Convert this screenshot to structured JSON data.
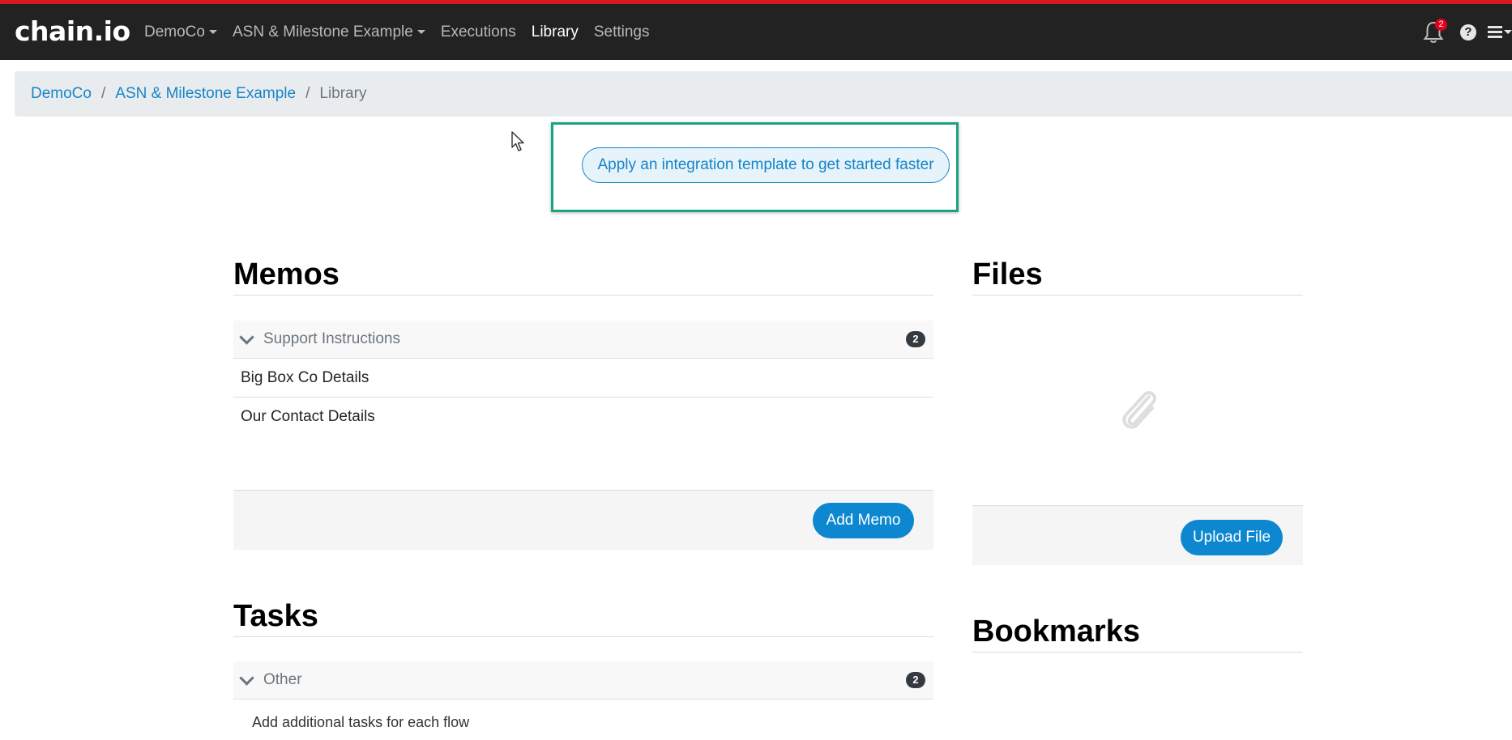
{
  "app": {
    "logo_text": "chain.io",
    "accent_color": "#d71920"
  },
  "nav": {
    "items": [
      {
        "label": "DemoCo",
        "dropdown": true
      },
      {
        "label": "ASN & Milestone Example",
        "dropdown": true
      },
      {
        "label": "Executions",
        "dropdown": false
      },
      {
        "label": "Library",
        "dropdown": false,
        "active": true
      },
      {
        "label": "Settings",
        "dropdown": false
      }
    ],
    "notifications_count": "2",
    "help_icon": "question-circle-icon",
    "menu_icon": "hamburger-menu-icon"
  },
  "breadcrumb": {
    "items": [
      "DemoCo",
      "ASN & Milestone Example"
    ],
    "current": "Library",
    "separator": "/"
  },
  "template_cta": {
    "label": "Apply an integration template to get started faster",
    "highlight_color": "#1aa380"
  },
  "memos": {
    "title": "Memos",
    "group": {
      "label": "Support Instructions",
      "count": "2"
    },
    "items": [
      "Big Box Co Details",
      "Our Contact Details"
    ],
    "add_label": "Add Memo"
  },
  "files": {
    "title": "Files",
    "empty_icon": "paperclip-icon",
    "upload_label": "Upload File"
  },
  "tasks": {
    "title": "Tasks",
    "group": {
      "label": "Other",
      "count": "2"
    },
    "items": [
      "Add additional tasks for each flow"
    ]
  },
  "bookmarks": {
    "title": "Bookmarks"
  }
}
